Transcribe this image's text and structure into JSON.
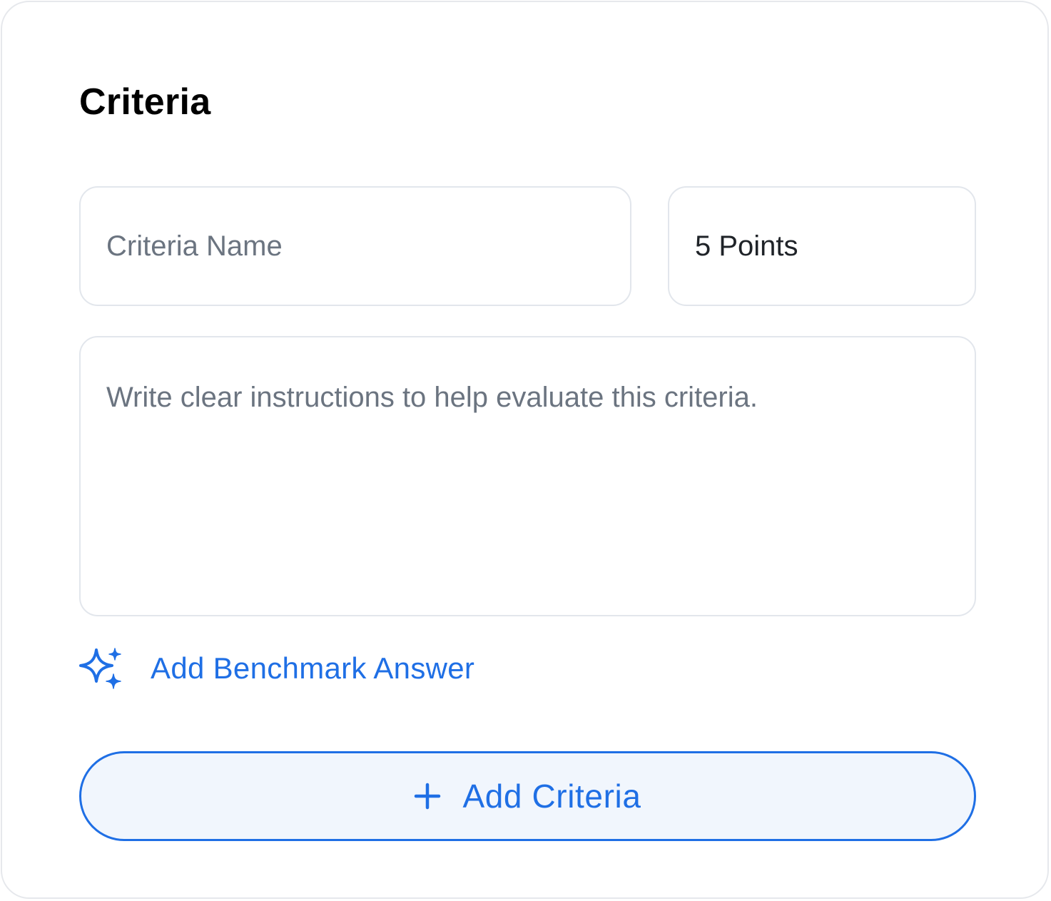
{
  "criteria_form": {
    "title": "Criteria",
    "name_placeholder": "Criteria Name",
    "points_value": "5 Points",
    "instructions_placeholder": "Write clear instructions to help evaluate this criteria.",
    "benchmark_label": "Add Benchmark Answer",
    "benchmark_icon": "sparkles-icon",
    "add_button_label": "Add Criteria",
    "add_button_icon": "plus-icon"
  },
  "colors": {
    "accent": "#1f6fe5",
    "button_background": "#f1f6fd",
    "border": "#e2e6ec",
    "placeholder": "#6b7480",
    "title": "#000000"
  }
}
